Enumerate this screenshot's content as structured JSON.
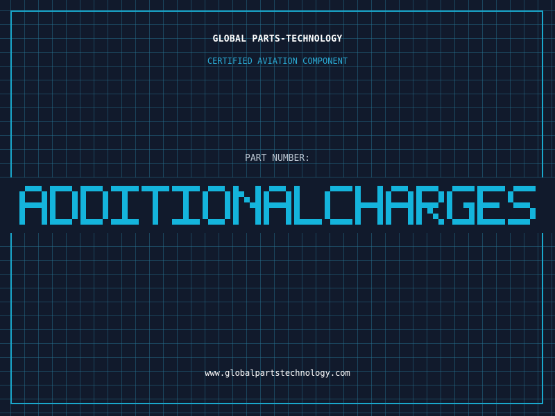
{
  "header": {
    "company": "GLOBAL PARTS-TECHNOLOGY",
    "tagline": "CERTIFIED AVIATION COMPONENT"
  },
  "part": {
    "label": "PART NUMBER:",
    "number": "ADDITIONALCHARGES"
  },
  "footer": {
    "url": "www.globalpartstechnology.com"
  },
  "colors": {
    "background": "#111a2c",
    "grid": "#287896",
    "frame": "#1aa8cc",
    "accent": "#14b4dc",
    "text": "#ffffff",
    "label": "#b9c3cf"
  }
}
